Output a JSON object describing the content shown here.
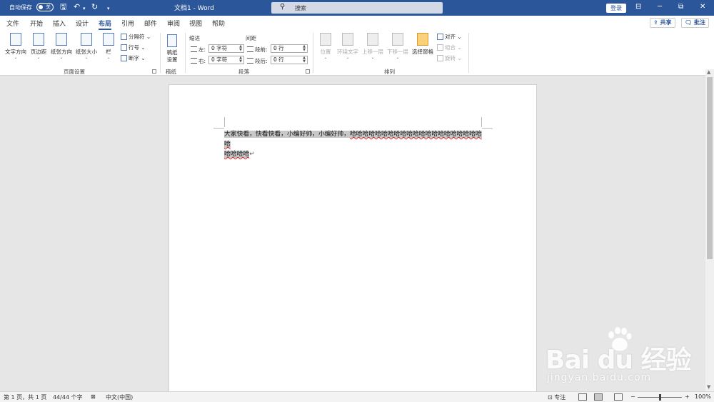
{
  "titlebar": {
    "autosave_label": "自动保存",
    "autosave_state": "关",
    "doc_title": "文档1  -  Word",
    "search_placeholder": "搜索",
    "login_label": "登录",
    "accent_color": "#2b579a"
  },
  "tabs": [
    "文件",
    "开始",
    "插入",
    "设计",
    "布局",
    "引用",
    "邮件",
    "审阅",
    "视图",
    "帮助"
  ],
  "active_tab": "布局",
  "actions": {
    "share": "共享",
    "comment": "批注"
  },
  "ribbon": {
    "page_setup": {
      "label": "页面设置",
      "text_direction": "文字方向",
      "margins": "页边距",
      "orientation": "纸张方向",
      "size": "纸张大小",
      "columns": "栏",
      "breaks": "分隔符",
      "line_numbers": "行号",
      "hyphenation": "断字"
    },
    "manuscript": {
      "label": "稿纸",
      "button": "稿纸\n设置"
    },
    "paragraph": {
      "label": "段落",
      "indent_header": "缩进",
      "spacing_header": "间距",
      "left_label": "左:",
      "right_label": "右:",
      "before_label": "段前:",
      "after_label": "段后:",
      "left_value": "0 字符",
      "right_value": "0 字符",
      "before_value": "0 行",
      "after_value": "0 行"
    },
    "arrange": {
      "label": "排列",
      "position": "位置",
      "wrap_text": "环绕文字",
      "bring_forward": "上移一层",
      "send_backward": "下移一层",
      "selection_pane": "选择窗格",
      "align": "对齐",
      "group": "组合",
      "rotate": "旋转"
    }
  },
  "document": {
    "text_plain": "大家快看，快看快看，小编好帅，小编好帅，",
    "text_squiggly_line1": "哈哈哈哈哈哈哈哈哈哈哈哈哈哈哈哈哈哈哈哈哈哈",
    "text_squiggly_line2": "哈哈哈哈",
    "paragraph_mark": "↵"
  },
  "statusbar": {
    "page": "第 1 页，共 1 页",
    "words": "44/44 个字",
    "language": "中文(中国)",
    "focus": "专注",
    "zoom": "100%"
  },
  "watermark": {
    "logo": "Bai du 经验",
    "url": "jingyan.baidu.com"
  }
}
